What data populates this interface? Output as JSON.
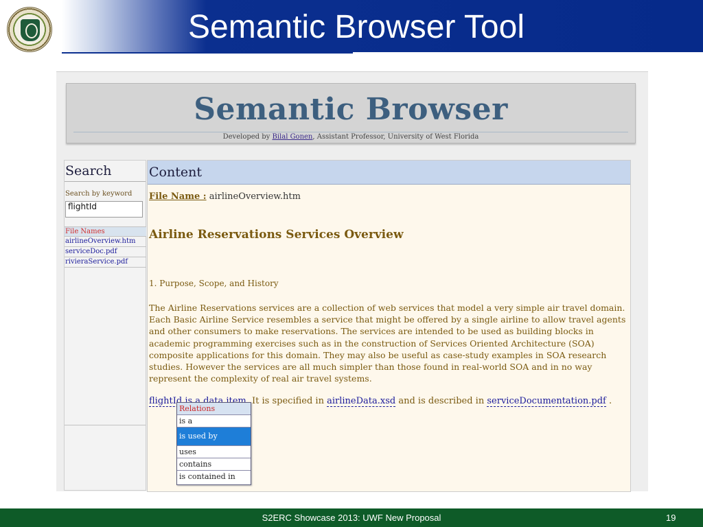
{
  "slide": {
    "title": "Semantic Browser Tool",
    "footer_text": "S2ERC Showcase 2013: UWF New Proposal",
    "page_number": "19"
  },
  "seal": {
    "text": "THE UNIVERSITY OF WEST FLORIDA"
  },
  "banner": {
    "title": "Semantic Browser",
    "subtitle_prefix": "Developed by ",
    "author": "Bilal Gonen",
    "subtitle_suffix": ", Assistant Professor, University of West Florida"
  },
  "search": {
    "heading": "Search",
    "keyword_label": "Search by keyword",
    "keyword_value": "flightId",
    "file_names_heading": "File Names",
    "files": [
      "airlineOverview.htm",
      "serviceDoc.pdf",
      "rivieraService.pdf"
    ]
  },
  "content": {
    "heading": "Content",
    "file_name_label": "File Name :",
    "file_name_value": "airlineOverview.htm",
    "doc_heading": "Airline Reservations Services Overview",
    "section_title": "1. Purpose, Scope, and History",
    "paragraph": "The Airline Reservations services are a collection of web services that model a very simple air travel domain. Each Basic Airline Service resembles a service that might be offered by a single airline to allow travel agents and other consumers to make reservations. The services are intended to be used as building blocks in academic programming exercises such as in the construction of Services Oriented Architecture (SOA) composite applications for this domain. They may also be useful as case-study examples in SOA research studies. However the services are all much simpler than those found in real-world SOA and in no way represent the complexity of real air travel systems.",
    "flight_term": "flightId is a data item",
    "flight_mid1": ". It is specified in ",
    "flight_link1": "airlineData.xsd",
    "flight_mid2": " and is described in ",
    "flight_link2": "serviceDocumentation.pdf",
    "flight_end": " ."
  },
  "relations": {
    "heading": "Relations",
    "items": [
      "is a",
      "is used by",
      "uses",
      "contains",
      "is contained in"
    ],
    "selected": "is used by"
  },
  "colors": {
    "header_blue": "#062a8a",
    "footer_green": "#0e5b28",
    "content_bg": "#fef8ec",
    "selected_blue": "#1e7ed8"
  }
}
